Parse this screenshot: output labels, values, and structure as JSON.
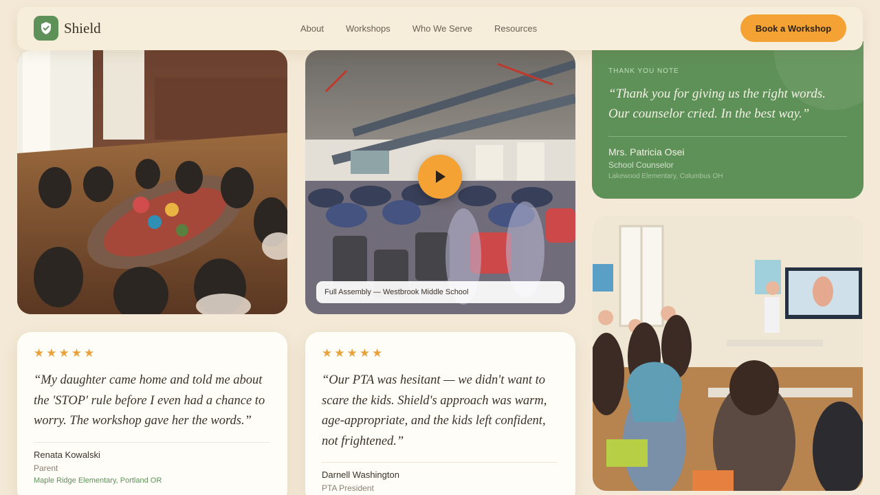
{
  "brand": {
    "name": "Shield",
    "icon": "shield-check-icon",
    "color": "#5e9158"
  },
  "nav": {
    "links": [
      "About",
      "Workshops",
      "Who We Serve",
      "Resources"
    ],
    "cta_label": "Book a Workshop",
    "cta_color": "#f3a233"
  },
  "photos": {
    "craft_circle": {
      "icon": "photo-image"
    },
    "assembly_video": {
      "icon": "play-icon",
      "caption": "Full Assembly — Westbrook Middle School"
    },
    "classroom": {
      "icon": "photo-image"
    }
  },
  "thank_you_note": {
    "eyebrow": "THANK YOU NOTE",
    "quote": "“Thank you for giving us the right words. Our counselor cried. In the best way.”",
    "name": "Mrs. Patricia Osei",
    "role": "School Counselor",
    "location": "Lakewood Elementary, Columbus OH"
  },
  "testimonials": [
    {
      "rating": 5,
      "stars": [
        "★",
        "★",
        "★",
        "★",
        "★"
      ],
      "quote": "“My daughter came home and told me about the 'STOP' rule before I even had a chance to worry. The workshop gave her the words.”",
      "name": "Renata Kowalski",
      "role": "Parent",
      "location": "Maple Ridge Elementary, Portland OR"
    },
    {
      "rating": 5,
      "stars": [
        "★",
        "★",
        "★",
        "★",
        "★"
      ],
      "quote": "“Our PTA was hesitant — we didn't want to scare the kids. Shield's approach was warm, age-appropriate, and the kids left confident, not frightened.”",
      "name": "Darnell Washington",
      "role": "PTA President"
    }
  ]
}
